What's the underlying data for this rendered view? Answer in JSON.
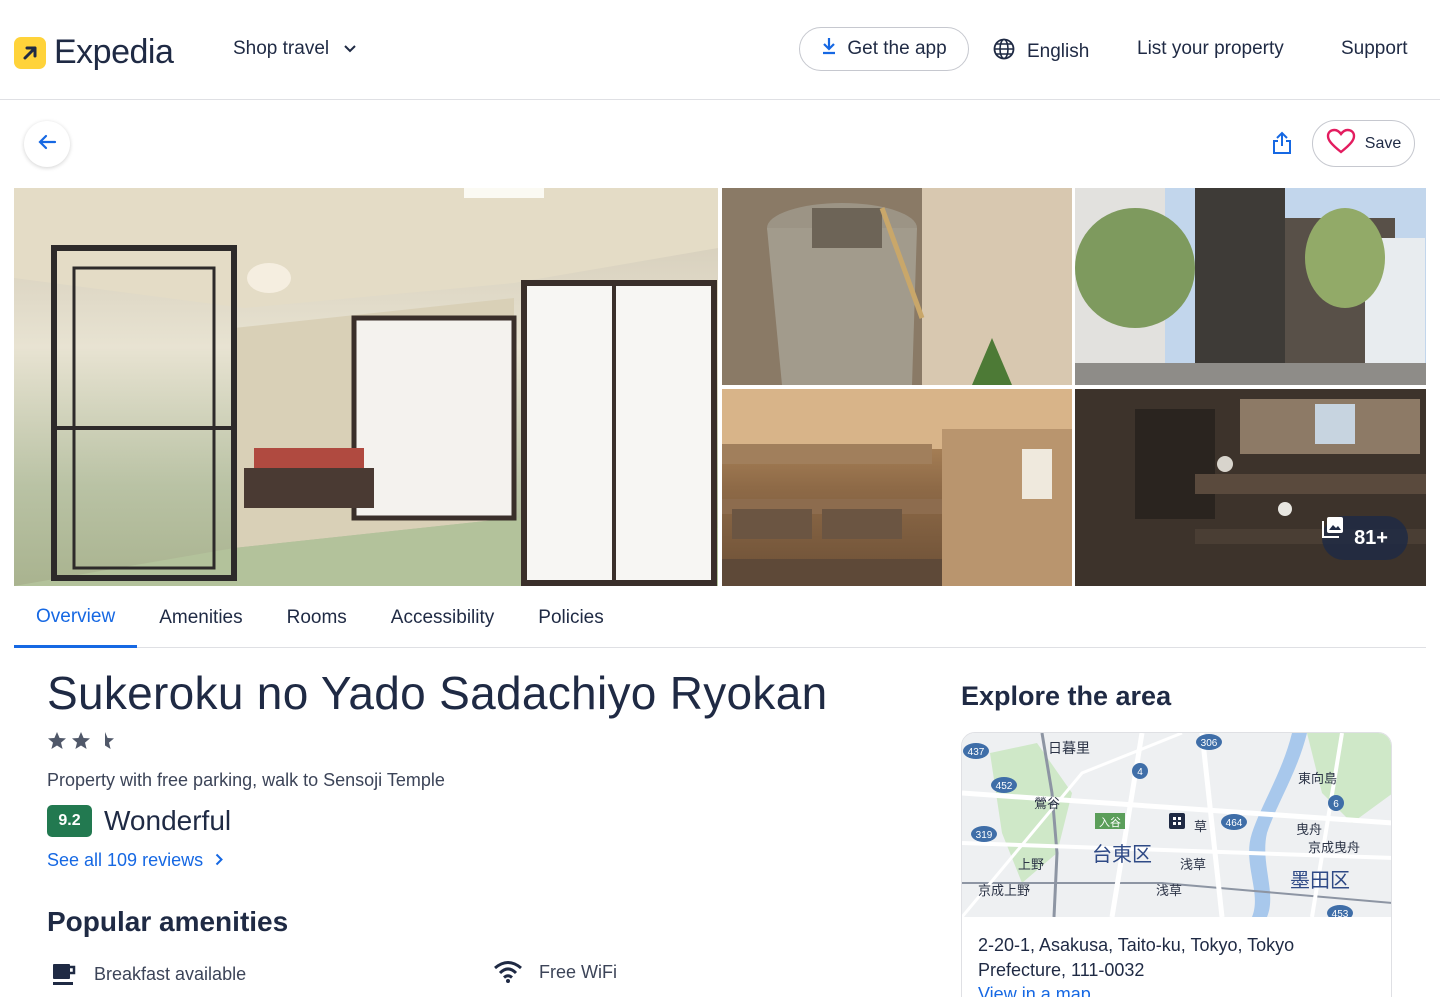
{
  "header": {
    "brand": "Expedia",
    "shop_travel": "Shop travel",
    "get_app": "Get the app",
    "language": "English",
    "list_property": "List your property",
    "support": "Support"
  },
  "actions": {
    "save_label": "Save"
  },
  "gallery": {
    "more_photos": "81+"
  },
  "tabs": [
    "Overview",
    "Amenities",
    "Rooms",
    "Accessibility",
    "Policies"
  ],
  "property": {
    "name": "Sukeroku no Yado Sadachiyo Ryokan",
    "star_rating": 2.5,
    "tagline": "Property with free parking, walk to Sensoji Temple",
    "score": "9.2",
    "score_word": "Wonderful",
    "reviews_link": "See all 109 reviews"
  },
  "amenities": {
    "title": "Popular amenities",
    "items": [
      {
        "label": "Breakfast available",
        "icon": "coffee-cup-icon"
      },
      {
        "label": "Free WiFi",
        "icon": "wifi-icon"
      }
    ]
  },
  "explore": {
    "title": "Explore the area",
    "address": "2-20-1, Asakusa, Taito-ku, Tokyo, Tokyo Prefecture, 111-0032",
    "view_map": "View in a map",
    "map_labels": {
      "nippori": "日暮里",
      "uguisudani": "鶯谷",
      "iriya": "入谷",
      "taito_ku": "台東区",
      "ueno": "上野",
      "keisei_ueno": "京成上野",
      "asakusa_1": "浅草",
      "asakusa_2": "浅草",
      "higashi_mukojima": "東向島",
      "hikifune": "曳舟",
      "keisei_hikifune": "京成曳舟",
      "sumida_ku": "墨田区",
      "kura": "草",
      "road_306": "306",
      "road_437": "437",
      "road_452": "452",
      "road_319": "319",
      "road_464": "464",
      "road_4": "4",
      "road_6": "6",
      "road_453": "453"
    }
  },
  "colors": {
    "brand_yellow": "#ffd33a",
    "link_blue": "#1668e3",
    "text_navy": "#1f2a44",
    "score_green": "#227950",
    "heart_red": "#e31c5f"
  }
}
